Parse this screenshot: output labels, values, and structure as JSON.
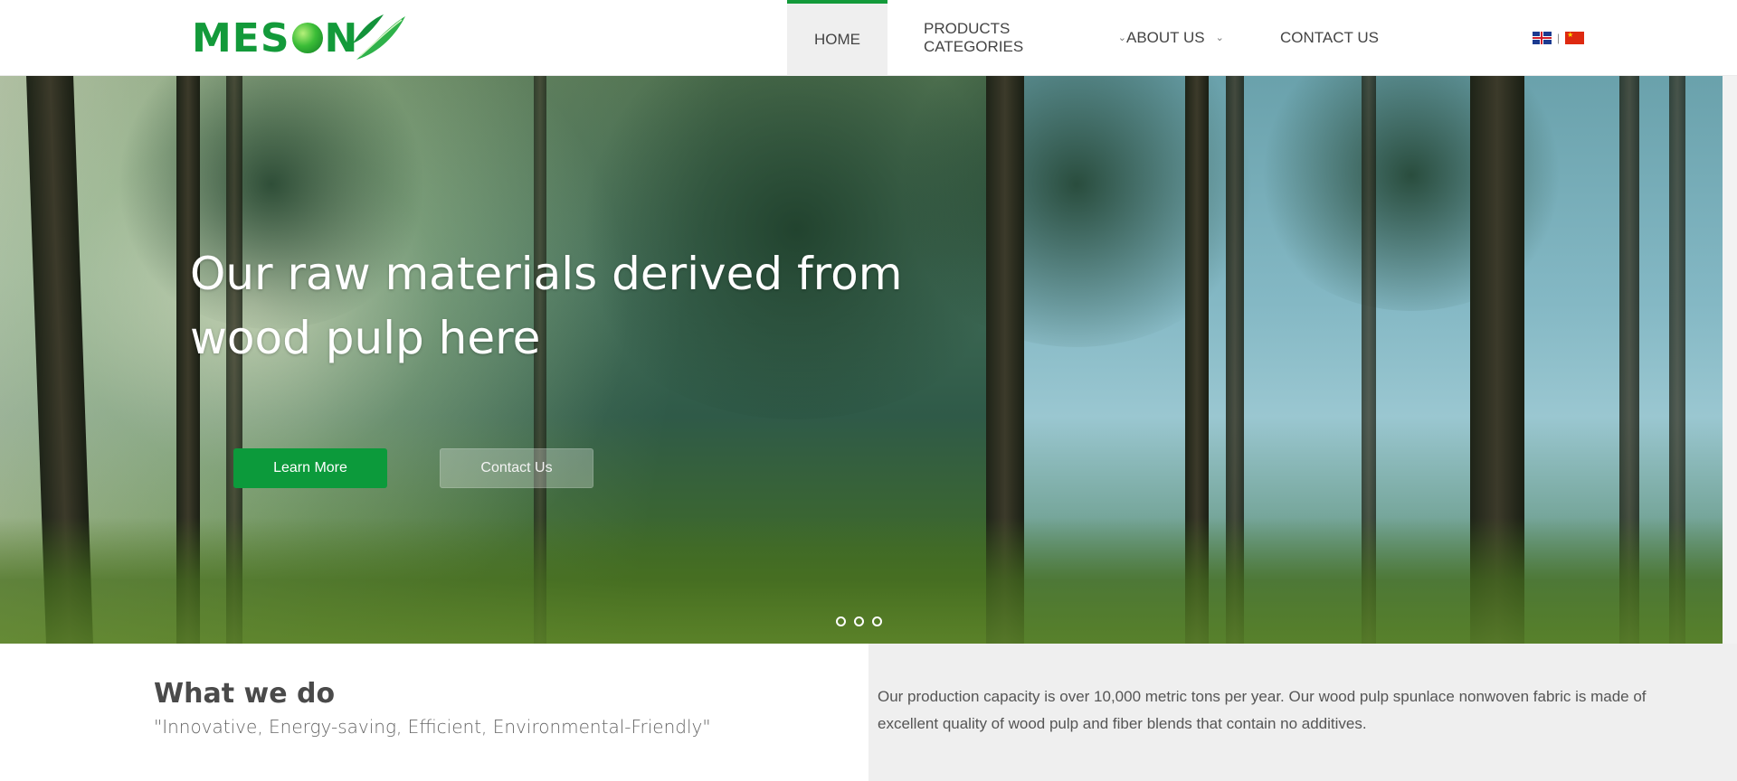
{
  "brand": {
    "name": "MESON",
    "primary_color": "#139a3a"
  },
  "nav": {
    "items": [
      {
        "label": "HOME",
        "active": true
      },
      {
        "label": "PRODUCTS CATEGORIES",
        "has_dropdown": true
      },
      {
        "label": "ABOUT US",
        "has_dropdown": true
      },
      {
        "label": "CONTACT US"
      }
    ],
    "languages": [
      "english-flag-icon",
      "chinese-flag-icon"
    ],
    "lang_separator": "|"
  },
  "hero": {
    "title": "Our raw materials derived from wood pulp here",
    "learn_more": "Learn More",
    "contact_us": "Contact Us",
    "slides": 3,
    "learn_more_color": "#0c9a3b"
  },
  "what_we_do": {
    "title": "What we do",
    "subtitle": "\"Innovative, Energy-saving, Efficient, Environmental-Friendly\"",
    "description": "Our production capacity is over 10,000 metric tons per year. Our wood pulp spunlace nonwoven fabric is made of excellent quality of wood pulp and fiber blends that contain no additives."
  }
}
